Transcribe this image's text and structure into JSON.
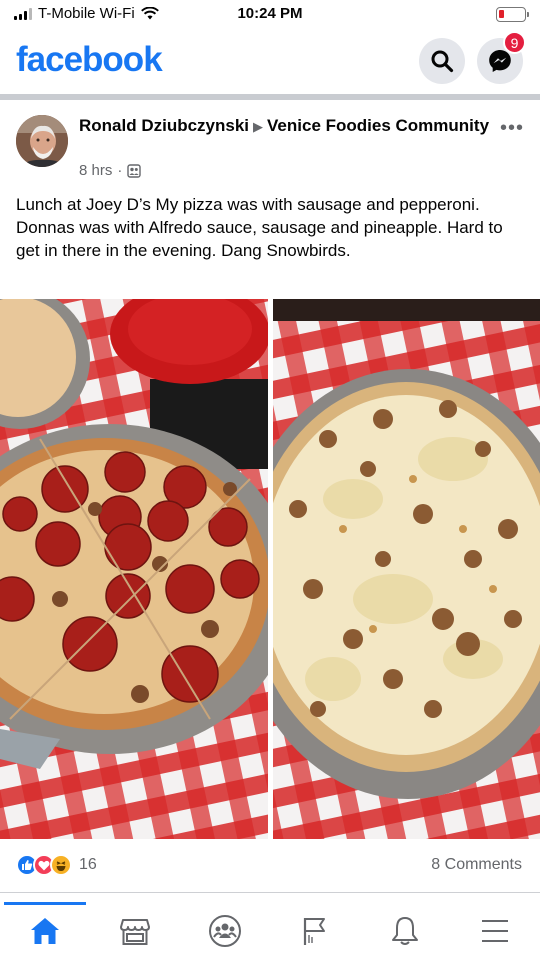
{
  "status_bar": {
    "carrier": "T-Mobile Wi-Fi",
    "time": "10:24 PM"
  },
  "header": {
    "logo": "facebook",
    "icons": [
      "search-icon",
      "messenger-icon"
    ],
    "messenger_badge": "9",
    "brand_color": "#1877f2"
  },
  "post": {
    "author": "Ronald Dziubczynski",
    "group": "Venice Foodies Community",
    "time": "8 hrs",
    "audience_icon": "group-members-icon",
    "text": "Lunch at Joey D’s   My pizza was with sausage and pepperoni.  Donnas was with Alfredo sauce, sausage and pineapple. Hard to get in there in the evening.  Dang Snowbirds.",
    "photos": [
      "pepperoni-sausage-pizza-photo",
      "alfredo-sausage-pineapple-pizza-photo"
    ],
    "reaction_icons": [
      "like-icon",
      "love-icon",
      "haha-icon"
    ],
    "reaction_count": "16",
    "comments": "8 Comments"
  },
  "bottom_nav": {
    "items": [
      "home-icon",
      "marketplace-icon",
      "groups-icon",
      "pages-flag-icon",
      "notifications-bell-icon",
      "menu-icon"
    ],
    "active": "home-icon"
  }
}
